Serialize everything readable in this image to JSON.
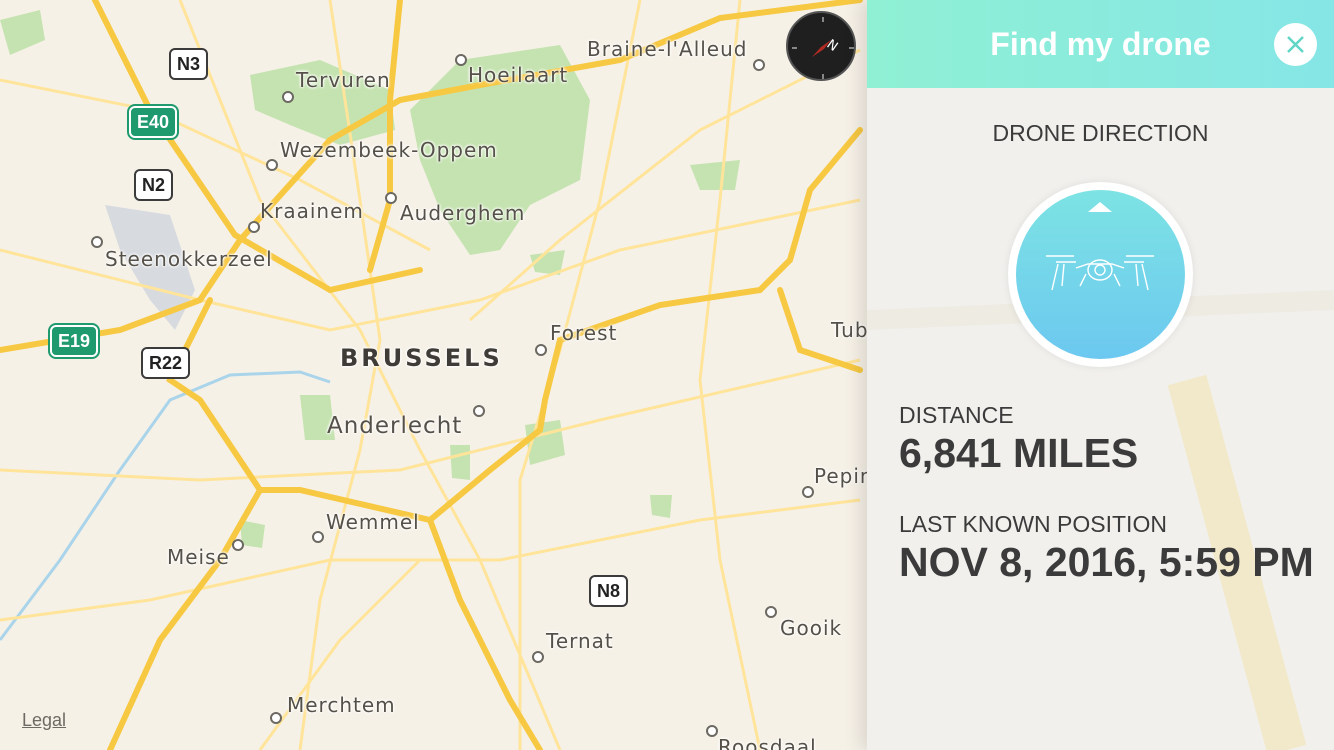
{
  "map": {
    "places": [
      {
        "key": "tervuren",
        "name": "Tervuren"
      },
      {
        "key": "hoeilaart",
        "name": "Hoeilaart"
      },
      {
        "key": "braine",
        "name": "Braine-l'Alleud"
      },
      {
        "key": "wezembeek",
        "name": "Wezembeek-Oppem"
      },
      {
        "key": "kraainem",
        "name": "Kraainem"
      },
      {
        "key": "auderghem",
        "name": "Auderghem"
      },
      {
        "key": "steenokkerzeel",
        "name": "Steenokkerzeel"
      },
      {
        "key": "forest",
        "name": "Forest"
      },
      {
        "key": "brussels",
        "name": "BRUSSELS"
      },
      {
        "key": "anderlecht",
        "name": "Anderlecht"
      },
      {
        "key": "wemmel",
        "name": "Wemmel"
      },
      {
        "key": "meise",
        "name": "Meise"
      },
      {
        "key": "ternat",
        "name": "Ternat"
      },
      {
        "key": "gooik",
        "name": "Gooik"
      },
      {
        "key": "merchtem",
        "name": "Merchtem"
      },
      {
        "key": "pepin",
        "name": "Pepin"
      },
      {
        "key": "tub",
        "name": "Tub"
      },
      {
        "key": "roosdaal",
        "name": "Roosdaal"
      }
    ],
    "road_shields": [
      {
        "key": "n3",
        "label": "N3",
        "style": "white"
      },
      {
        "key": "e40",
        "label": "E40",
        "style": "green"
      },
      {
        "key": "n2",
        "label": "N2",
        "style": "white"
      },
      {
        "key": "e19",
        "label": "E19",
        "style": "green"
      },
      {
        "key": "r22",
        "label": "R22",
        "style": "white"
      },
      {
        "key": "n8",
        "label": "N8",
        "style": "white"
      }
    ],
    "legal_label": "Legal",
    "compass_icon": "compass-icon",
    "colors": {
      "land": "#f6f1e7",
      "road": "#f7c842",
      "park": "#c5e3b0",
      "water": "#a9d4ea"
    }
  },
  "panel": {
    "title": "Find my drone",
    "close_icon": "close-icon",
    "direction_label": "DRONE DIRECTION",
    "drone_icon": "drone-icon",
    "distance_label": "DISTANCE",
    "distance_value": "6,841 MILES",
    "position_label": "LAST KNOWN POSITION",
    "position_value": "NOV 8, 2016, 5:59 PM",
    "colors": {
      "header_start": "#8ff0d4",
      "header_end": "#86e6e6",
      "circle_top": "#7de3e3",
      "circle_bottom": "#6cc8f0",
      "text": "#3b3b3b"
    }
  }
}
